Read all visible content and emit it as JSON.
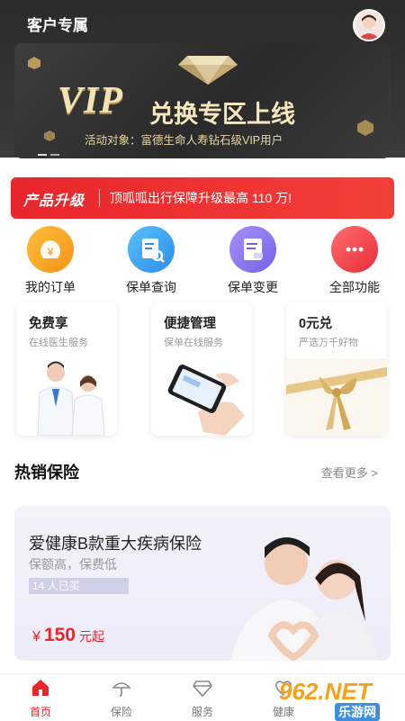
{
  "header": {
    "title": "客户专属"
  },
  "banner": {
    "vip_text": "VIP",
    "headline": "兑换专区上线",
    "activity": "活动对象：富德生命人寿钻石级VIP用户"
  },
  "promo": {
    "tag": "产品升级",
    "text": "顶呱呱出行保障升级最高 110 万!"
  },
  "quick_actions": [
    {
      "label": "我的订单",
      "icon": "yen-bag-icon",
      "color": "#f7a223"
    },
    {
      "label": "保单查询",
      "icon": "search-document-icon",
      "color": "#3aa9f2"
    },
    {
      "label": "保单变更",
      "icon": "edit-document-icon",
      "color": "#8f7df0"
    },
    {
      "label": "全部功能",
      "icon": "more-dots-icon",
      "color": "#f0484f"
    }
  ],
  "cards": [
    {
      "title": "免费享",
      "sub": "在线医生服务"
    },
    {
      "title": "便捷管理",
      "sub": "保单在线服务"
    },
    {
      "title": "0元兑",
      "sub": "严选万千好物"
    }
  ],
  "hot": {
    "title": "热销保险",
    "more": "查看更多 >"
  },
  "product": {
    "title": "爱健康B款重大疾病保险",
    "desc": "保额高，保费低",
    "buyers": "14 人已买",
    "price_symbol": "¥",
    "price": "150",
    "price_unit": "元起"
  },
  "tabs": [
    {
      "label": "首页",
      "icon": "home-icon",
      "active": true
    },
    {
      "label": "保险",
      "icon": "umbrella-icon",
      "active": false
    },
    {
      "label": "服务",
      "icon": "diamond-icon",
      "active": false
    },
    {
      "label": "健康",
      "icon": "heart-icon",
      "active": false
    }
  ],
  "watermark": {
    "brand": "962.NET",
    "site": "乐游网"
  },
  "colors": {
    "accent": "#e8262c",
    "gold": "#f3e2b3"
  }
}
